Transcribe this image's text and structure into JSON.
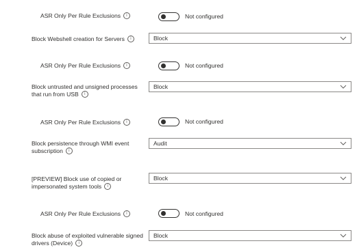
{
  "info_glyph": "i",
  "rows": [
    {
      "type": "toggle",
      "label": "ASR Only Per Rule Exclusions",
      "status": "Not configured"
    },
    {
      "type": "select",
      "label": "Block Webshell creation for Servers",
      "value": "Block"
    },
    {
      "type": "toggle",
      "label": "ASR Only Per Rule Exclusions",
      "status": "Not configured"
    },
    {
      "type": "select",
      "label": "Block untrusted and unsigned processes that run from USB",
      "value": "Block"
    },
    {
      "type": "toggle",
      "label": "ASR Only Per Rule Exclusions",
      "status": "Not configured"
    },
    {
      "type": "select",
      "label": "Block persistence through WMI event subscription",
      "value": "Audit"
    },
    {
      "type": "select",
      "label": "[PREVIEW] Block use of copied or impersonated system tools",
      "value": "Block"
    },
    {
      "type": "toggle",
      "label": "ASR Only Per Rule Exclusions",
      "status": "Not configured"
    },
    {
      "type": "select",
      "label": "Block abuse of exploited vulnerable signed drivers (Device)",
      "value": "Block"
    }
  ]
}
